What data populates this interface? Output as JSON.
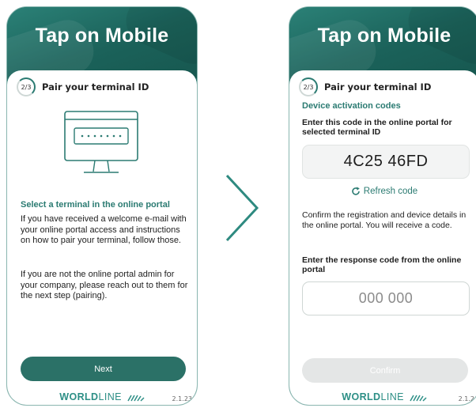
{
  "left_screen": {
    "header_title": "Tap on Mobile",
    "step_badge": "2/3",
    "step_label": "Pair your terminal ID",
    "heading": "Select a terminal in the online portal",
    "paragraph_1": "If you have received a welcome e-mail with your online portal access and instructions on how to pair your terminal, follow those.",
    "paragraph_2": "If you are not the online portal admin for your company, please reach out to them for the next step (pairing).",
    "next_label": "Next",
    "logo_bold": "WORLD",
    "logo_light": "LINE",
    "version": "2.1.23"
  },
  "right_screen": {
    "header_title": "Tap on Mobile",
    "step_badge": "2/3",
    "step_label": "Pair your terminal ID",
    "subheading": "Device activation codes",
    "code_instruction": "Enter this code in the online portal for selected terminal ID",
    "activation_code": "4C25 46FD",
    "refresh_label": "Refresh code",
    "confirm_text": "Confirm the registration and device details in the online portal. You will receive a code.",
    "response_instruction": "Enter the response code from the online portal",
    "response_placeholder": "000 000",
    "confirm_label": "Confirm",
    "logo_bold": "WORLD",
    "logo_light": "LINE",
    "version": "2.1.2"
  },
  "colors": {
    "brand_teal": "#2b7b72",
    "button_teal": "#2b7167",
    "header_teal": "#1e6c64",
    "disabled_button": "#e4e6e6",
    "logo_teal": "#2d8f86"
  },
  "icons": {
    "terminal": "terminal-monitor-icon",
    "refresh": "refresh-icon",
    "progress": "step-progress-icon",
    "arrow": "chevron-right-icon",
    "logo_waves": "worldline-waves-icon"
  }
}
